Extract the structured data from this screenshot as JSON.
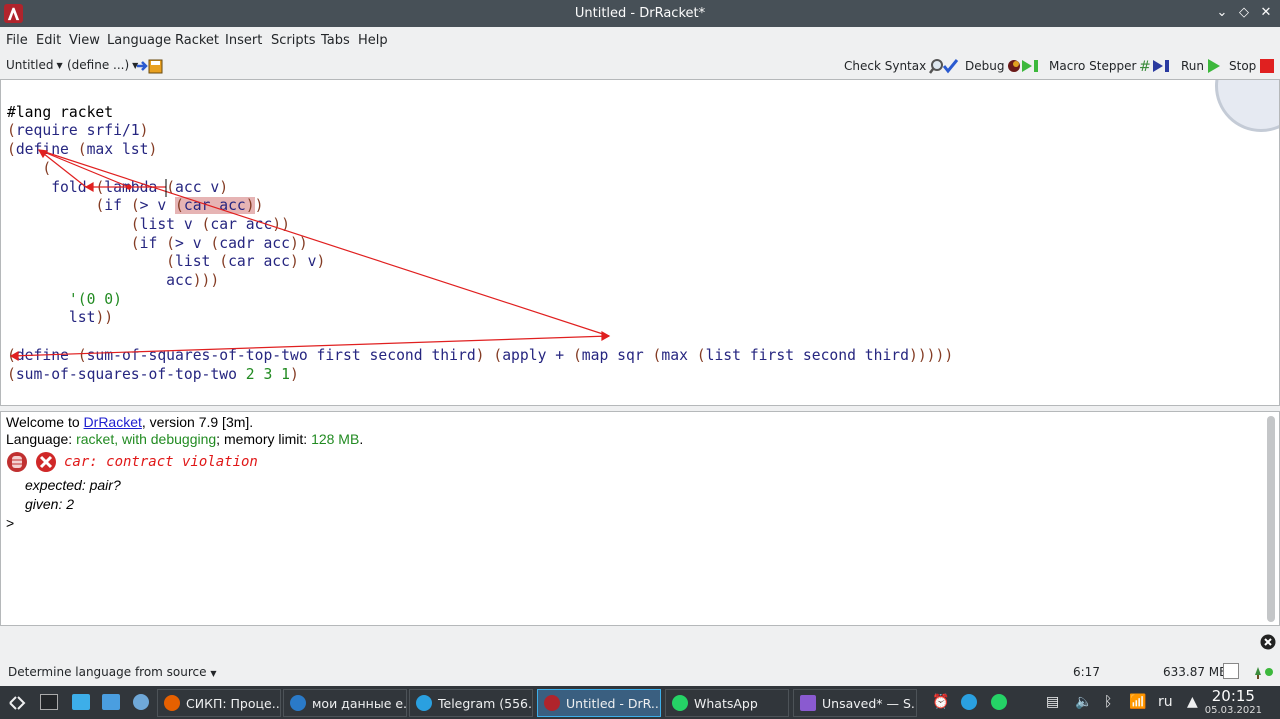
{
  "window": {
    "title": "Untitled - DrRacket*"
  },
  "menu": [
    "File",
    "Edit",
    "View",
    "Language",
    "Racket",
    "Insert",
    "Scripts",
    "Tabs",
    "Help"
  ],
  "toolbar": {
    "untitled": "Untitled",
    "define": "(define ...)",
    "check_syntax": "Check Syntax",
    "debug": "Debug",
    "macro_stepper": "Macro Stepper",
    "run": "Run",
    "stop": "Stop"
  },
  "editor": {
    "lines": [
      "#lang racket",
      "(require srfi/1)",
      "(define (max lst)",
      "    (",
      "     fold (lambda (acc v)",
      "          (if (> v (car acc))",
      "              (list v (car acc))",
      "              (if (> v (cadr acc))",
      "                  (list (car acc) v)",
      "                  acc)))",
      "       '(0 0)",
      "       lst))",
      "",
      "(define (sum-of-squares-of-top-two first second third) (apply + (map sqr (max (list first second third)))))",
      "(sum-of-squares-of-top-two 2 3 1)"
    ]
  },
  "repl": {
    "welcome_prefix": "Welcome to ",
    "welcome_link": "DrRacket",
    "welcome_suffix": ", version 7.9 [3m].",
    "language_prefix": "Language: ",
    "language_value": "racket, with debugging",
    "memory_prefix": "; memory limit: ",
    "memory_value": "128 MB",
    "memory_suffix": ".",
    "error_line1": "car: contract violation",
    "error_line2": "expected: pair?",
    "error_line3": "given: 2",
    "prompt": ">"
  },
  "status": {
    "language_source": "Determine language from source",
    "position": "6:17",
    "memory": "633.87 MB"
  },
  "taskbar": {
    "tasks": [
      {
        "label": "СИКП: Проце..."
      },
      {
        "label": "мои данные е..."
      },
      {
        "label": "Telegram (556..."
      },
      {
        "label": "Untitled - DrR..."
      },
      {
        "label": "WhatsApp"
      },
      {
        "label": "Unsaved* — S..."
      }
    ],
    "lang": "ru",
    "time": "20:15",
    "date": "05.03.2021"
  }
}
